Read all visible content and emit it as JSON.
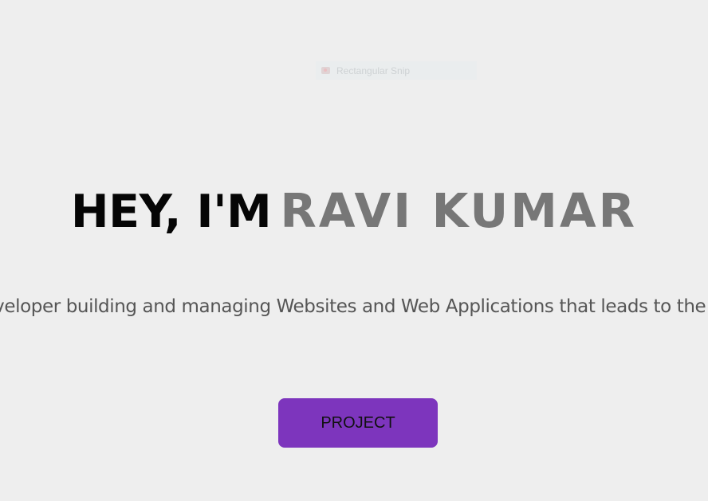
{
  "overlay": {
    "label": "Rectangular Snip",
    "icon": "snip-icon"
  },
  "hero": {
    "greeting": "HEY, I'M",
    "name": "RAVI KUMAR",
    "greeting_color": "#050505",
    "name_color": "#777777"
  },
  "tagline": {
    "text": "A Web Developer building and managing Websites and Web Applications that leads to the success of the overall product"
  },
  "cta": {
    "label": "PROJECT",
    "color": "#7d35bd"
  },
  "theme": {
    "background": "#eeeeee",
    "text": "#555555"
  }
}
